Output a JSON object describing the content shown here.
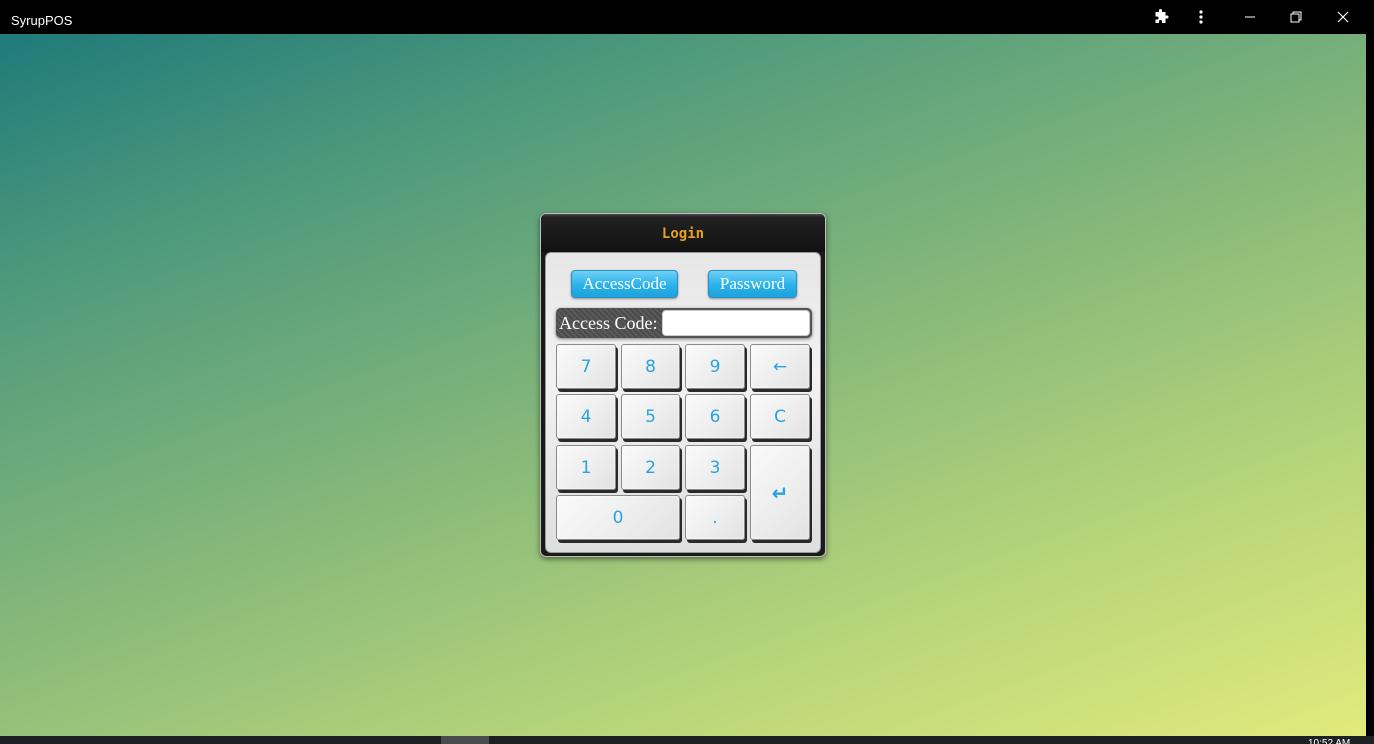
{
  "window": {
    "title": "SyrupPOS",
    "extensions_icon": "puzzle-icon",
    "menu_icon": "kebab-menu-icon",
    "minimize_icon": "minimize-icon",
    "restore_icon": "restore-icon",
    "close_icon": "close-icon"
  },
  "taskbar": {
    "clock": "10:52 AM"
  },
  "dialog": {
    "title": "Login",
    "tabs": {
      "access_code": "AccessCode",
      "password": "Password"
    },
    "field": {
      "label": "Access Code:",
      "value": ""
    },
    "keypad": {
      "k7": "7",
      "k8": "8",
      "k9": "9",
      "backspace": "←",
      "k4": "4",
      "k5": "5",
      "k6": "6",
      "clear": "C",
      "k1": "1",
      "k2": "2",
      "k3": "3",
      "enter": "↵",
      "k0": "0",
      "dot": "."
    }
  },
  "colors": {
    "title_text": "#e8a020",
    "key_text": "#27a3e0",
    "tab_button": "#2ab2ea",
    "gradient_start": "#1f7a79",
    "gradient_end": "#e2ea7c"
  }
}
